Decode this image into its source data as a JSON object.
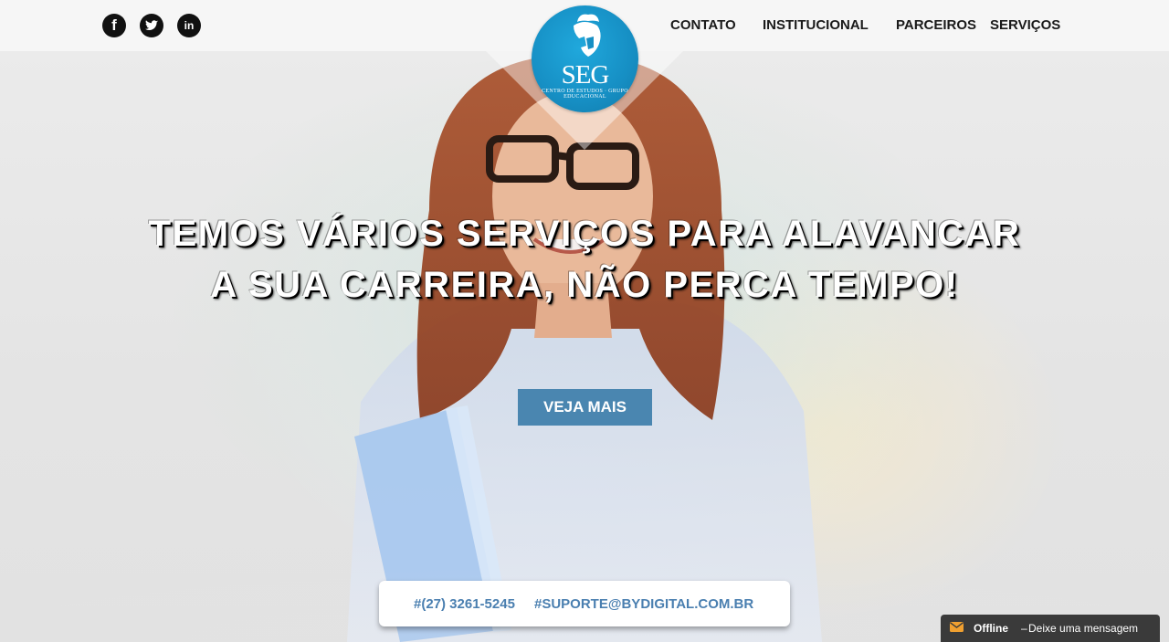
{
  "brand": {
    "logo_text": "SEG",
    "logo_subtext": "CENTRO DE ESTUDOS · GRUPO EDUCACIONAL",
    "accent_color": "#168fc4"
  },
  "social": {
    "facebook_glyph": "f",
    "twitter_icon": "twitter-bird-icon",
    "linkedin_glyph": "in"
  },
  "nav": {
    "items": [
      {
        "label": "CONTATO"
      },
      {
        "label": "INSTITUCIONAL"
      },
      {
        "label": "PARCEIROS"
      },
      {
        "label": "SERVIÇOS"
      }
    ]
  },
  "hero": {
    "headline_line1": "TEMOS VÁRIOS SERVIÇOS PARA ALAVANCAR",
    "headline_line2": "A SUA CARREIRA, NÃO PERCA TEMPO!",
    "cta_label": "VEJA MAIS",
    "cta_color": "#4a86b0"
  },
  "contact": {
    "phone": "#(27) 3261-5245",
    "email": "#SUPORTE@BYDIGITAL.COM.BR",
    "text_color": "#4a7fb0"
  },
  "chat": {
    "status": "Offline",
    "separator": "–",
    "message": "Deixe uma mensagem",
    "icon": "envelope-icon"
  }
}
